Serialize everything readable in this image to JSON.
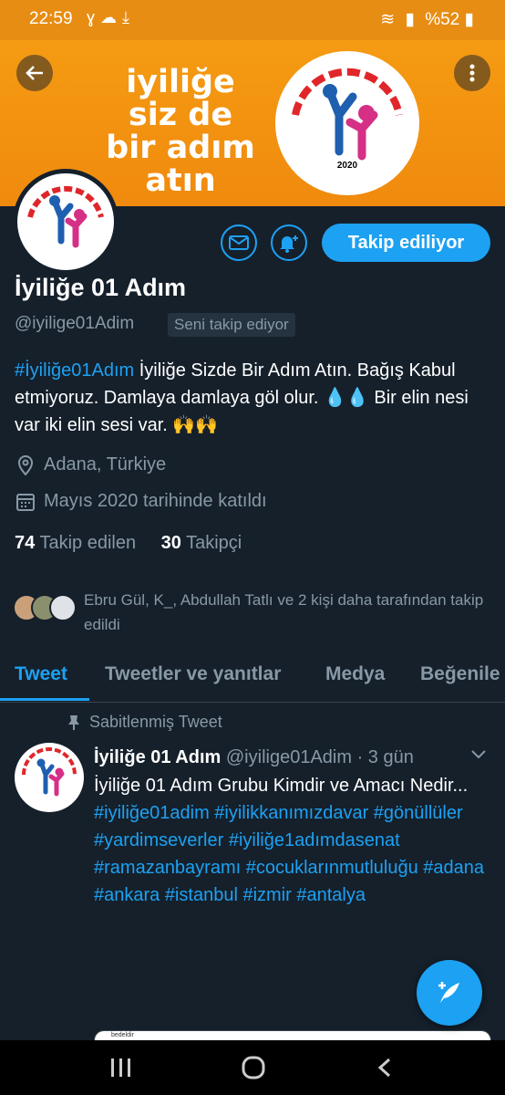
{
  "status_bar": {
    "time": "22:59",
    "battery": "%52"
  },
  "banner": {
    "text": "iyiliğe siz de bir adım atın",
    "logo_year": "2020"
  },
  "profile": {
    "name": "İyiliğe 01 Adım",
    "handle": "@iyilige01Adim",
    "follows_you": "Seni takip ediyor",
    "follow_button": "Takip ediliyor",
    "bio_hashtag": "#İyiliğe01Adım",
    "bio_text": " İyiliğe Sizde Bir Adım Atın. Bağış Kabul etmiyoruz. Damlaya damlaya göl olur. 💧💧 Bir elin nesi var iki elin sesi var. 🙌🙌",
    "location": "Adana, Türkiye",
    "joined": "Mayıs 2020 tarihinde katıldı",
    "following_count": "74",
    "following_label": "Takip edilen",
    "followers_count": "30",
    "followers_label": "Takipçi",
    "followed_by": "Ebru Gül, K_, Abdullah Tatlı ve 2 kişi daha tarafından takip edildi"
  },
  "tabs": [
    {
      "label": "Tweet"
    },
    {
      "label": "Tweetler ve yanıtlar"
    },
    {
      "label": "Medya"
    },
    {
      "label": "Beğenile"
    }
  ],
  "pinned_tweet": {
    "pinned_label": "Sabitlenmiş Tweet",
    "author": "İyiliğe 01 Adım",
    "handle_time": "@iyilige01Adim · 3 gün",
    "text": "İyiliğe 01 Adım Grubu Kimdir ve Amacı Nedir...",
    "hashtags": "#iyiliğe01adim  #iyilikkanımızdavar  #gönüllüler  #yardimseverler #iyiliğe1adımdasenat #ramazanbayramı #cocuklarınmutluluğu #adana #ankara #istanbul #izmir #antalya",
    "card_text": "bedeldir"
  },
  "colors": {
    "background": "#15202b",
    "accent": "#1da1f2",
    "banner": "#f08a0e",
    "muted": "#8899a6"
  }
}
